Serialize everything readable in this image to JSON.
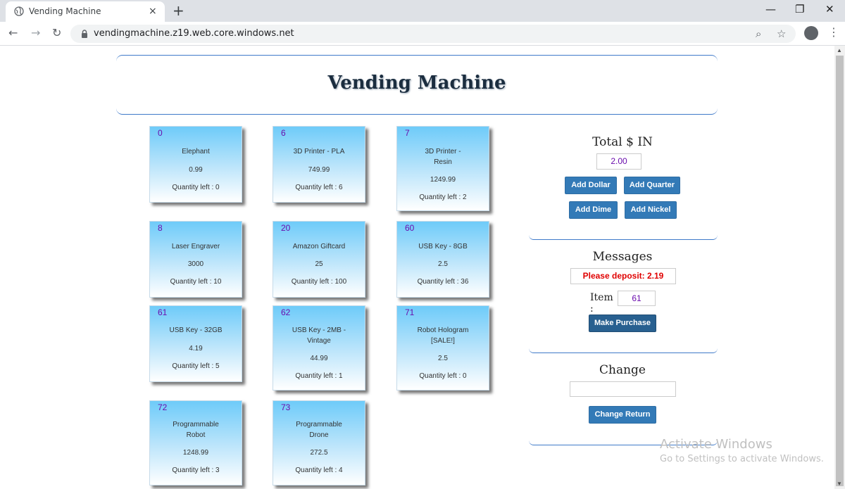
{
  "browser": {
    "tab_title": "Vending Machine",
    "tab_close": "×",
    "new_tab": "+",
    "url": "vendingmachine.z19.web.core.windows.net",
    "minimize": "—",
    "restore": "❐",
    "close": "✕",
    "back": "←",
    "forward": "→",
    "reload": "↻",
    "zoom_icon": "⌕",
    "star_icon": "☆",
    "menu_icon": "⋮"
  },
  "page": {
    "title": "Vending Machine"
  },
  "items": [
    {
      "id": "0",
      "name": "Elephant",
      "price": "0.99",
      "quantity": "Quantity left : 0"
    },
    {
      "id": "6",
      "name": "3D Printer - PLA",
      "price": "749.99",
      "quantity": "Quantity left : 6"
    },
    {
      "id": "7",
      "name": "3D Printer - Resin",
      "name_line1": "3D Printer -",
      "name_line2": "Resin",
      "price": "1249.99",
      "quantity": "Quantity left : 2"
    },
    {
      "id": "8",
      "name": "Laser Engraver",
      "price": "3000",
      "quantity": "Quantity left : 10"
    },
    {
      "id": "20",
      "name": "Amazon Giftcard",
      "price": "25",
      "quantity": "Quantity left : 100"
    },
    {
      "id": "60",
      "name": "USB Key - 8GB",
      "price": "2.5",
      "quantity": "Quantity left : 36"
    },
    {
      "id": "61",
      "name": "USB Key - 32GB",
      "price": "4.19",
      "quantity": "Quantity left : 5"
    },
    {
      "id": "62",
      "name": "USB Key - 2MB - Vintage",
      "name_line1": "USB Key - 2MB -",
      "name_line2": "Vintage",
      "price": "44.99",
      "quantity": "Quantity left : 1"
    },
    {
      "id": "71",
      "name": "Robot Hologram [SALE!]",
      "name_line1": "Robot Hologram",
      "name_line2": "[SALE!]",
      "price": "2.5",
      "quantity": "Quantity left : 0"
    },
    {
      "id": "72",
      "name": "Programmable Robot",
      "name_line1": "Programmable",
      "name_line2": "Robot",
      "price": "1248.99",
      "quantity": "Quantity left : 3"
    },
    {
      "id": "73",
      "name": "Programmable Drone",
      "name_line1": "Programmable",
      "name_line2": "Drone",
      "price": "272.5",
      "quantity": "Quantity left : 4"
    }
  ],
  "money": {
    "heading": "Total $ IN",
    "total": "2.00",
    "add_dollar": "Add Dollar",
    "add_quarter": "Add Quarter",
    "add_dime": "Add Dime",
    "add_nickel": "Add Nickel"
  },
  "messages": {
    "heading": "Messages",
    "message": "Please deposit: 2.19",
    "message_color": "#e00000",
    "item_label": "Item :",
    "item_value": "61",
    "make_purchase": "Make Purchase"
  },
  "change": {
    "heading": "Change",
    "value": "",
    "change_return": "Change Return"
  },
  "watermark": {
    "line1": "Activate Windows",
    "line2": "Go to Settings to activate Windows."
  },
  "colors": {
    "accent": "#337ab7",
    "item_number": "#6a0dad",
    "rule": "#3f7ac9"
  }
}
